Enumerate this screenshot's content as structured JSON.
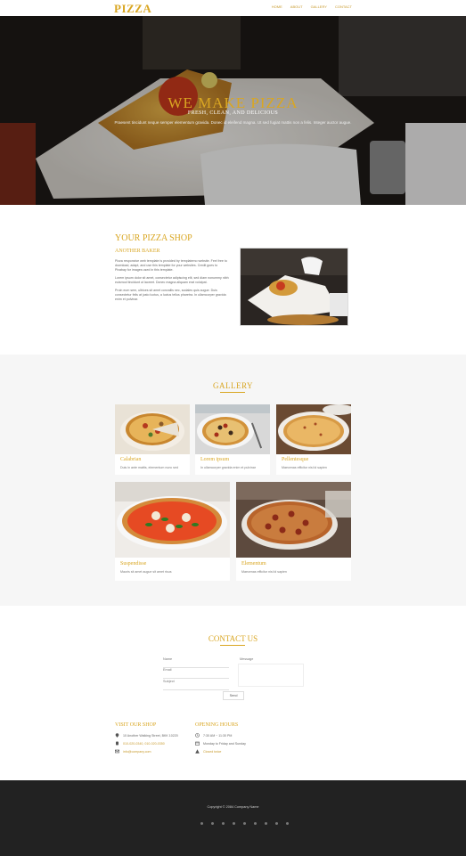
{
  "nav": {
    "logo": "PIZZA",
    "links": [
      "HOME",
      "ABOUT",
      "GALLERY",
      "CONTACT"
    ]
  },
  "hero": {
    "title": "WE MAKE PIZZA",
    "subtitle": "FRESH, CLEAN, AND DELICIOUS",
    "description": "Praesent tincidunt neque semper elementum gravida. Donec id eleifend magna. Ut sed fugiat mattis non a felis. Integer auctor augue."
  },
  "about": {
    "title": "YOUR PIZZA SHOP",
    "subtitle": "ANOTHER BAKER",
    "paragraphs": [
      "Pizza responsive web template is provided by templatemo website. Feel free to download, adapt, and use this template for your websites. Credit goes to Pixabay for images used in this template.",
      "Lorem ipsum dolor sit amet, consectetur adipiscing elit, sed diam nonummy nibh euismod tincidunt ut laoreet. Donec magna aliquam erat volutpat.",
      "Proin eum sem, ultrices sit amet convallis nec, sodales quis augue. Duis consectetur felis at justo luctus, a luctus tellus pharetra. In ullamcorper gravida enim et pulvinar."
    ]
  },
  "gallery": {
    "title": "GALLERY",
    "items": [
      {
        "name": "Calabrian",
        "desc": "Duis in ante mattis, elementum nunc sed"
      },
      {
        "name": "Lorem ipsum",
        "desc": "In ullamcorper gravida enim et pulvinar"
      },
      {
        "name": "Pellentesque",
        "desc": "Maecenas efficitur nisi id sapien"
      },
      {
        "name": "Suspendisse",
        "desc": "Mauris sit amet augue sit amet risus"
      },
      {
        "name": "Elementum",
        "desc": "Maecenas efficitur nisi id sapien"
      }
    ]
  },
  "contact": {
    "title": "CONTACT US",
    "labels": {
      "name": "Name",
      "email": "Email",
      "subject": "Subject",
      "message": "Message"
    },
    "send": "Send"
  },
  "visit": {
    "title": "VISIT OUR SHOP",
    "address": "10 Another Walking Street, BKK 10220",
    "phone": "010-020-0340, 010-020-0350",
    "email": "info@company.com"
  },
  "hours": {
    "title": "OPENING HOURS",
    "time": "7:30 AM ~ 11:30 PM",
    "days": "Monday to Friday and Sunday",
    "closed": "Closed twice"
  },
  "footer": {
    "copyright": "Copyright © 2084 Company Name"
  },
  "colors": {
    "accent": "#d9a622",
    "footer_bg": "#222222",
    "gallery_bg": "#f6f6f6"
  }
}
